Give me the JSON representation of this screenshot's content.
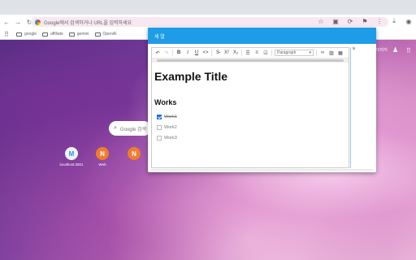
{
  "browser": {
    "omnibox_text": "Google에서 검색하거나 URL을 입력하세요",
    "bookmarks": [
      "google",
      "affiliate",
      "gemini",
      "OpenAI"
    ]
  },
  "newtab": {
    "search_placeholder": "Google 검색",
    "right_link": "이미지",
    "shortcuts": [
      {
        "label": "localhost:3001",
        "letter": "M",
        "color": "#5aa8e6"
      },
      {
        "label": "Web",
        "letter": "N",
        "color": "#f07d2c"
      },
      {
        "label": "",
        "letter": "N",
        "color": "#f07d2c"
      }
    ]
  },
  "dialog": {
    "title": "세 열",
    "side_label": "ls",
    "toolbar": {
      "paragraph": "Paragraph"
    },
    "doc": {
      "title": "Example Title",
      "section": "Works",
      "tasks": [
        {
          "label": "Work1",
          "checked": true
        },
        {
          "label": "Work2",
          "checked": false
        },
        {
          "label": "Work3",
          "checked": false
        }
      ]
    }
  }
}
